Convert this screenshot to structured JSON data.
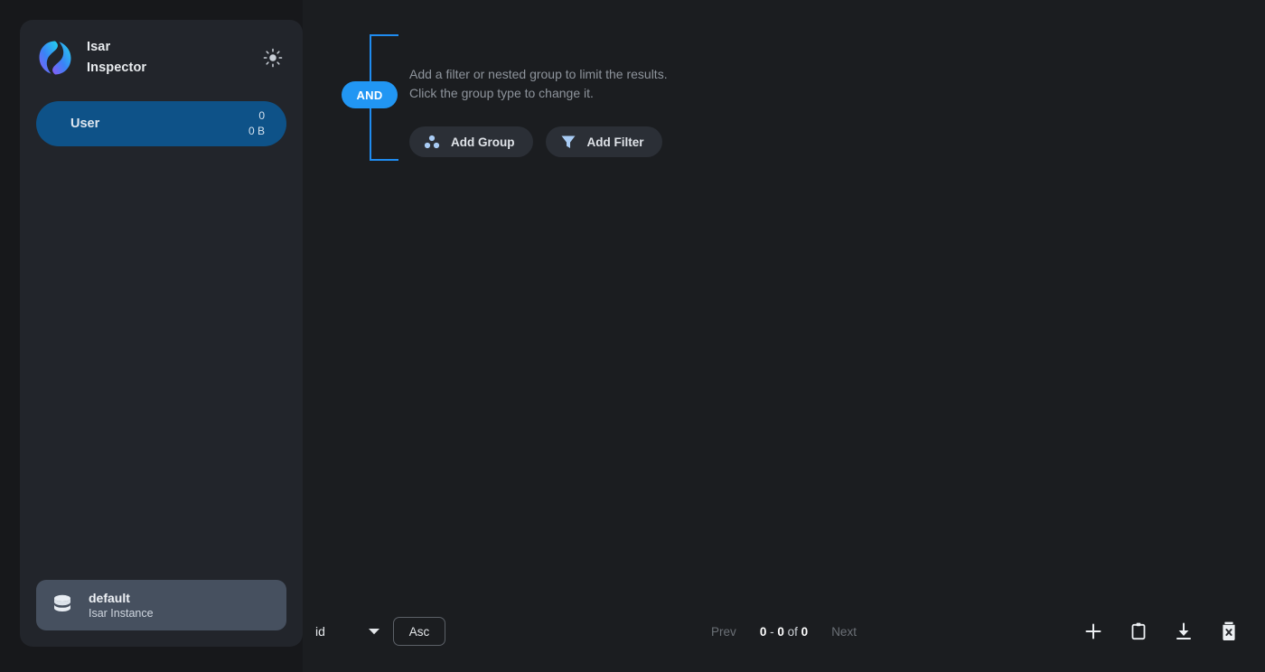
{
  "app": {
    "title_line1": "Isar",
    "title_line2": "Inspector",
    "logo_icon": "isar-logo-icon",
    "theme_toggle_icon": "sun-icon",
    "accent_blue": "#2196f3",
    "selected_blue": "#0e5288",
    "window_bg": "#17181b",
    "sidebar_bg": "#22252b",
    "main_bg": "#1b1d20"
  },
  "sidebar": {
    "collections": [
      {
        "name": "User",
        "count": "0",
        "size": "0 B",
        "selected": true
      }
    ],
    "instance": {
      "icon": "database-icon",
      "name": "default",
      "subtitle": "Isar Instance"
    }
  },
  "filter_group": {
    "group_type": "AND",
    "hint_line1": "Add a filter or nested group to limit the results.",
    "hint_line2": "Click the group type to change it.",
    "buttons": [
      {
        "label": "Add Group",
        "icon": "three-dots-group-icon"
      },
      {
        "label": "Add Filter",
        "icon": "funnel-icon"
      }
    ]
  },
  "bottom_bar": {
    "sort_field": "id",
    "sort_field_options": [
      "id"
    ],
    "sort_direction": "Asc",
    "dropdown_icon": "chevron-down-icon",
    "pagination": {
      "prev_label": "Prev",
      "next_label": "Next",
      "range_start": "0",
      "range_separator": "-",
      "range_end": "0",
      "of_label": "of",
      "total": "0",
      "prev_enabled": false,
      "next_enabled": false
    },
    "actions": [
      {
        "name": "add-row-button",
        "icon": "plus-icon"
      },
      {
        "name": "paste-button",
        "icon": "clipboard-icon"
      },
      {
        "name": "export-button",
        "icon": "download-icon"
      },
      {
        "name": "clear-all-button",
        "icon": "trash-x-icon"
      }
    ]
  }
}
